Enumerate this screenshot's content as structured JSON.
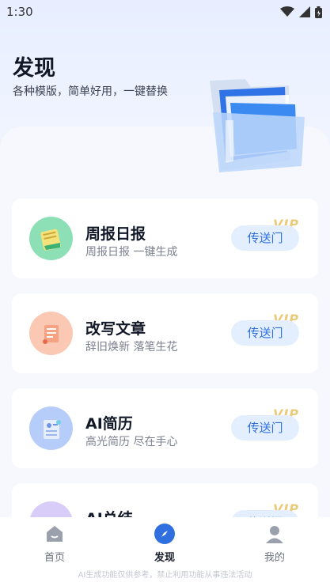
{
  "status_bar": {
    "time": "1:30"
  },
  "hero": {
    "title": "发现",
    "subtitle": "各种模版，简单好用，一键替换"
  },
  "cards": [
    {
      "title": "周报日报",
      "desc": "周报日报 一键生成",
      "badge": "VIP",
      "button": "传送门",
      "icon": "notebook-icon",
      "icon_color": "#59c98e"
    },
    {
      "title": "改写文章",
      "desc": "辞旧焕新 落笔生花",
      "badge": "VIP",
      "button": "传送门",
      "icon": "scroll-icon",
      "icon_color": "#f28a6b"
    },
    {
      "title": "AI简历",
      "desc": "高光简历 尽在手心",
      "badge": "VIP",
      "button": "传送门",
      "icon": "resume-icon",
      "icon_color": "#5f8cf0"
    },
    {
      "title": "AI总结",
      "desc": "",
      "badge": "VIP",
      "button": "传送门",
      "icon": "summary-icon",
      "icon_color": "#a98cf2"
    }
  ],
  "nav": {
    "home": "首页",
    "discover": "发现",
    "mine": "我的"
  },
  "disclaimer": "AI生成功能仅供参考，禁止利用功能从事违法活动",
  "colors": {
    "accent": "#2f6fe0",
    "vip": "#e9c66b",
    "button_bg": "#e3efff"
  }
}
